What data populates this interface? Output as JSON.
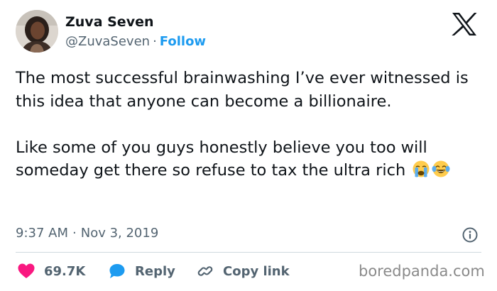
{
  "header": {
    "display_name": "Zuva Seven",
    "handle": "@ZuvaSeven",
    "separator": "·",
    "follow_label": "Follow",
    "logo_icon": "x-logo-icon"
  },
  "tweet": {
    "paragraph_1": "The most successful brainwashing I’ve ever witnessed is this idea that anyone can become a billionaire.",
    "paragraph_2": "Like some of you guys honestly believe you too will someday get there so refuse to tax the ultra rich",
    "emojis": [
      "loudly-crying-face-icon",
      "face-with-tears-of-joy-icon"
    ]
  },
  "meta": {
    "time": "9:37 AM",
    "separator": "·",
    "date": "Nov 3, 2019",
    "info_icon": "info-icon"
  },
  "actions": {
    "like_count": "69.7K",
    "reply_label": "Reply",
    "copy_link_label": "Copy link"
  },
  "watermark": "boredpanda.com",
  "colors": {
    "text": "#0f1419",
    "secondary": "#536471",
    "accent": "#1d9bf0",
    "like": "#f91880",
    "divider": "#cfd9de"
  }
}
